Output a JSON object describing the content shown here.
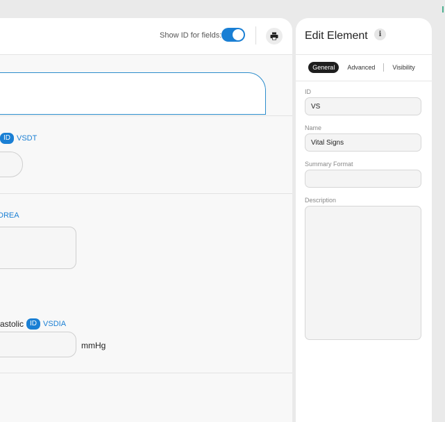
{
  "toolbar": {
    "show_id_label": "Show ID for fields:",
    "show_id_enabled": true,
    "print_icon": "printer-icon"
  },
  "fields": {
    "date_time_id": "VSDT",
    "resp_id": "DREA",
    "diastolic_label": "astolic",
    "diastolic_id": "VSDIA",
    "diastolic_unit": "mmHg",
    "id_badge": "ID"
  },
  "editor": {
    "title": "Edit Element",
    "info_icon": "i",
    "tabs": [
      "General",
      "Advanced",
      "Visibility"
    ],
    "active_tab": "General",
    "id_label": "ID",
    "id_value": "VS",
    "name_label": "Name",
    "name_value": "Vital Signs",
    "summary_label": "Summary Format",
    "summary_value": "",
    "description_label": "Description",
    "description_value": ""
  },
  "colors": {
    "accent": "#1a7fd4",
    "background": "#eaeaea",
    "active_tab": "#1e1e1e"
  }
}
